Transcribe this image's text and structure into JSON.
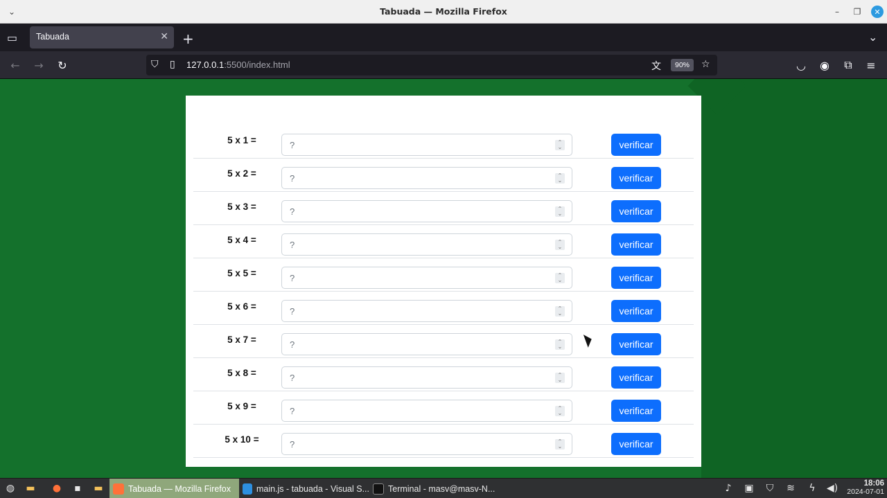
{
  "window": {
    "title": "Tabuada — Mozilla Firefox"
  },
  "tabs": [
    {
      "label": "Tabuada"
    }
  ],
  "navbar": {
    "url_host": "127.0.0.1",
    "url_rest": ":5500/index.html",
    "zoom": "90%"
  },
  "table": {
    "rows": [
      {
        "question": "5 x 1 =",
        "placeholder": "?",
        "button": "verificar"
      },
      {
        "question": "5 x 2 =",
        "placeholder": "?",
        "button": "verificar"
      },
      {
        "question": "5 x 3 =",
        "placeholder": "?",
        "button": "verificar"
      },
      {
        "question": "5 x 4 =",
        "placeholder": "?",
        "button": "verificar"
      },
      {
        "question": "5 x 5 =",
        "placeholder": "?",
        "button": "verificar"
      },
      {
        "question": "5 x 6 =",
        "placeholder": "?",
        "button": "verificar"
      },
      {
        "question": "5 x 7 =",
        "placeholder": "?",
        "button": "verificar"
      },
      {
        "question": "5 x 8 =",
        "placeholder": "?",
        "button": "verificar"
      },
      {
        "question": "5 x 9 =",
        "placeholder": "?",
        "button": "verificar"
      },
      {
        "question": "5 x 10 =",
        "placeholder": "?",
        "button": "verificar"
      }
    ]
  },
  "taskbar": {
    "tasks": [
      {
        "label": "Tabuada — Mozilla Firefox",
        "icon": "firefox-icon",
        "active": true
      },
      {
        "label": "main.js - tabuada - Visual S...",
        "icon": "vscode-icon",
        "active": false
      },
      {
        "label": "Terminal - masv@masv-N...",
        "icon": "terminal-icon",
        "active": false
      }
    ],
    "time": "18:06",
    "date": "2024-07-01"
  },
  "colors": {
    "page_bg": "#14712c",
    "button": "#0d6efd",
    "active_task": "#8fa77b"
  }
}
